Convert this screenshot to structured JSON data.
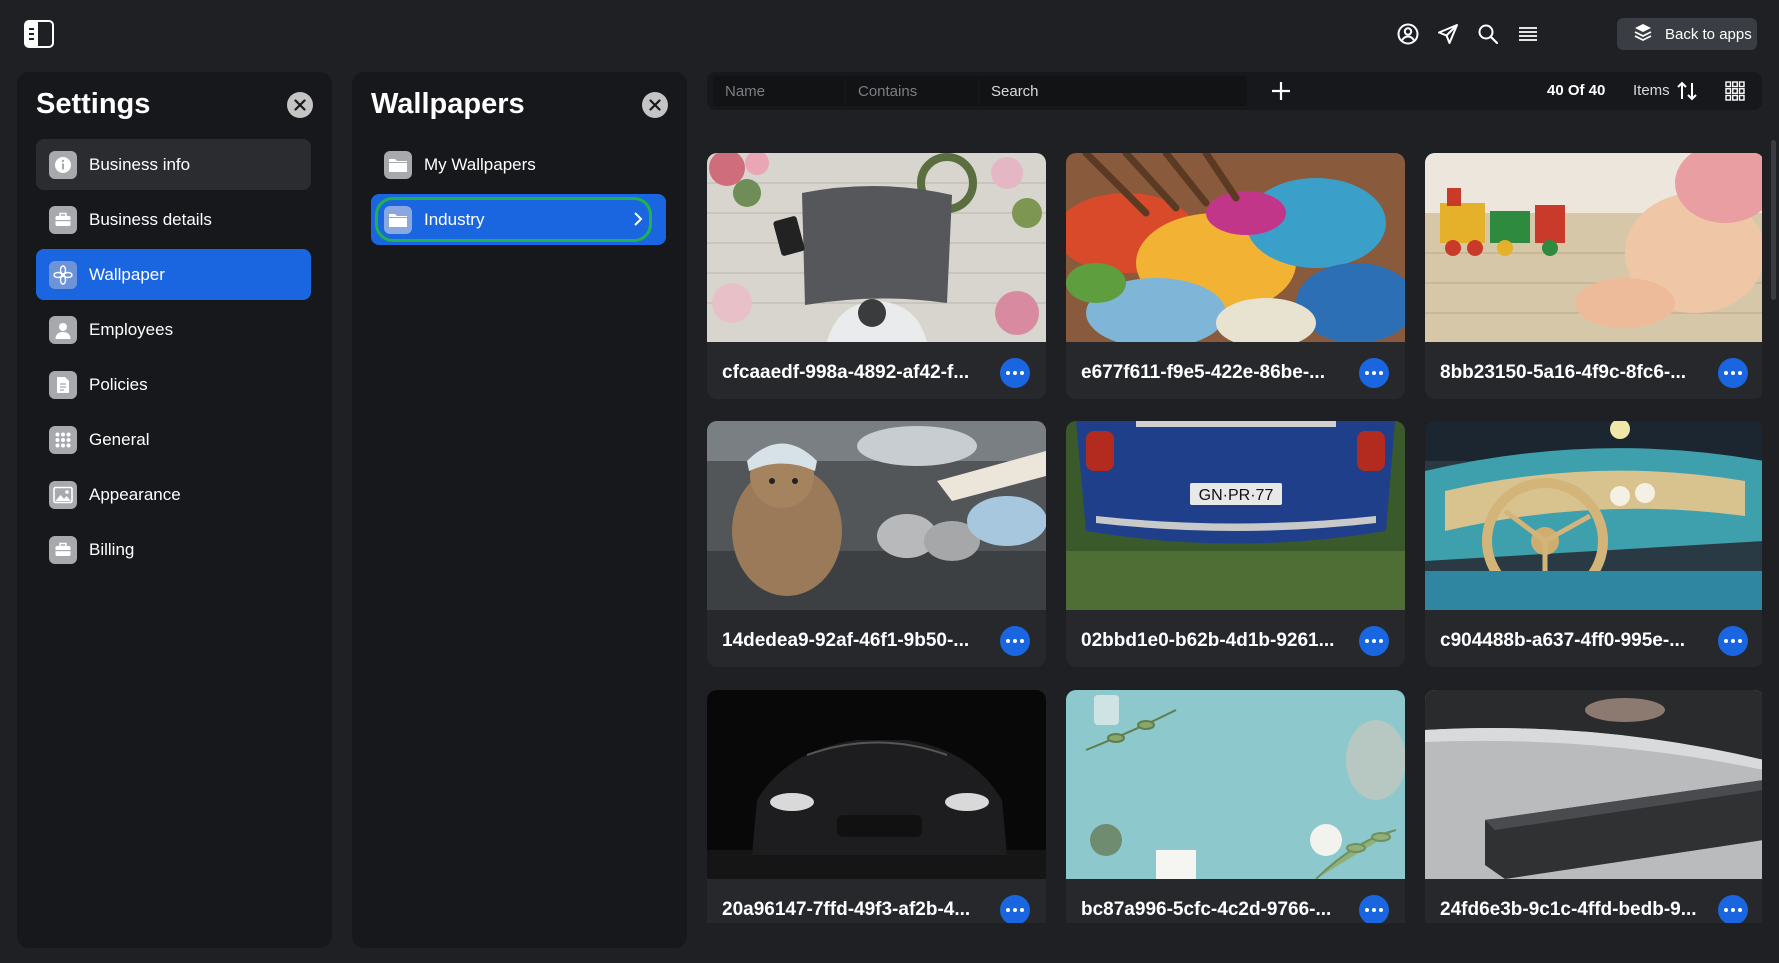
{
  "topbar": {
    "icons": [
      "sidebar-toggle-icon",
      "user-circle-icon",
      "send-icon",
      "search-icon",
      "menu-icon"
    ],
    "back_label": "Back to apps"
  },
  "settings": {
    "title": "Settings",
    "items": [
      {
        "label": "Business info",
        "icon": "info-icon",
        "state": "hover"
      },
      {
        "label": "Business details",
        "icon": "briefcase-icon",
        "state": ""
      },
      {
        "label": "Wallpaper",
        "icon": "flower-icon",
        "state": "active"
      },
      {
        "label": "Employees",
        "icon": "person-icon",
        "state": ""
      },
      {
        "label": "Policies",
        "icon": "document-icon",
        "state": ""
      },
      {
        "label": "General",
        "icon": "grid-dots-icon",
        "state": ""
      },
      {
        "label": "Appearance",
        "icon": "image-icon",
        "state": ""
      },
      {
        "label": "Billing",
        "icon": "briefcase-icon",
        "state": ""
      }
    ]
  },
  "wallpapers": {
    "title": "Wallpapers",
    "folders": [
      {
        "label": "My Wallpapers",
        "active": false
      },
      {
        "label": "Industry",
        "active": true
      }
    ]
  },
  "toolbar": {
    "name_placeholder": "Name",
    "contains_placeholder": "Contains",
    "search_placeholder": "Search",
    "count": "40 Of 40",
    "items_label": "Items"
  },
  "gallery": [
    {
      "label": "cfcaaedf-998a-4892-af42-f...",
      "scene": "flowers-paper"
    },
    {
      "label": "e677f611-f9e5-422e-86be-...",
      "scene": "paint-palette"
    },
    {
      "label": "8bb23150-5a16-4f9c-8fc6-...",
      "scene": "toy-train"
    },
    {
      "label": "14dedea9-92af-46f1-9b50-...",
      "scene": "teddy-shoes"
    },
    {
      "label": "02bbd1e0-b62b-4d1b-9261...",
      "scene": "blue-car"
    },
    {
      "label": "c904488b-a637-4ff0-995e-...",
      "scene": "car-interior"
    },
    {
      "label": "20a96147-7ffd-49f3-af2b-4...",
      "scene": "black-car"
    },
    {
      "label": "bc87a996-5cfc-4c2d-9766-...",
      "scene": "teal-flowers"
    },
    {
      "label": "24fd6e3b-9c1c-4ffd-bedb-9...",
      "scene": "soundbar"
    }
  ]
}
